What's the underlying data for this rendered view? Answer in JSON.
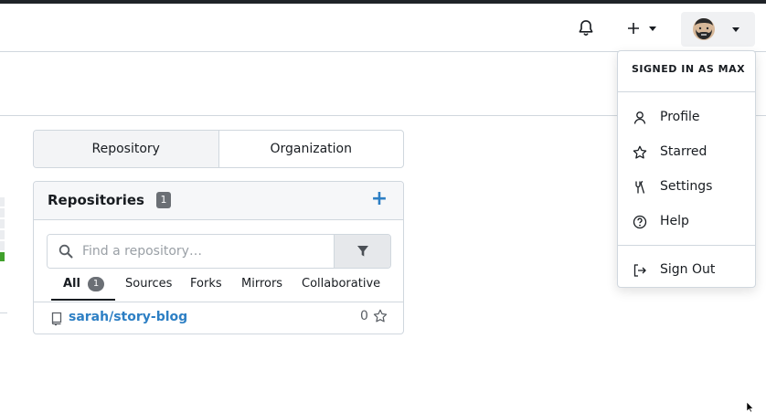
{
  "navbar": {
    "icons": [
      "bell-icon",
      "plus-icon",
      "avatar",
      "chevron-down-icon"
    ]
  },
  "tabs": {
    "repository_label": "Repository",
    "organization_label": "Organization",
    "active": "Repository"
  },
  "repos_panel": {
    "title": "Repositories",
    "count": "1",
    "add_symbol": "+",
    "search": {
      "placeholder": "Find a repository…",
      "value": ""
    },
    "filter_tabs": [
      {
        "label": "All",
        "count": "1",
        "active": true
      },
      {
        "label": "Sources"
      },
      {
        "label": "Forks"
      },
      {
        "label": "Mirrors"
      },
      {
        "label": "Collaborative"
      }
    ],
    "items": [
      {
        "name": "sarah/story-blog",
        "stars": "0"
      }
    ]
  },
  "user_menu": {
    "header": "SIGNED IN AS MAX",
    "items": [
      {
        "label": "Profile",
        "icon": "person-icon"
      },
      {
        "label": "Starred",
        "icon": "star-icon"
      },
      {
        "label": "Settings",
        "icon": "tools-icon"
      },
      {
        "label": "Help",
        "icon": "question-icon"
      }
    ],
    "signout": {
      "label": "Sign Out",
      "icon": "sign-out-icon"
    }
  },
  "colors": {
    "accent": "#2d7fc4",
    "badge": "#6b6f75",
    "border": "#d0d7de"
  }
}
